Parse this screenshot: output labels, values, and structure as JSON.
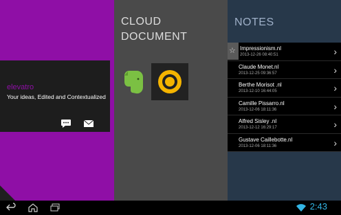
{
  "left_panel": {
    "brand": "elevatro",
    "tagline": "Your ideas, Edited and Contextualized",
    "icons": [
      "chat-icon",
      "mail-icon"
    ],
    "color": "#8f0fa6"
  },
  "mid_panel": {
    "title_line1": "CLOUD",
    "title_line2": "DOCUMENT",
    "apps": [
      "evernote-icon",
      "chrome-icon"
    ]
  },
  "right_panel": {
    "title": "NOTES",
    "notes": [
      {
        "title": "Impressionism.nl",
        "date": "2013-12-26 08:40:51"
      },
      {
        "title": "Claude Monet.nl",
        "date": "2013-12-25 09:36:57"
      },
      {
        "title": "Berthe Morisot .nl",
        "date": "2013-12-10 16:44:05"
      },
      {
        "title": "Camille Pissarro.nl",
        "date": "2013-12-06 18:11:36"
      },
      {
        "title": "Alfred Sisley .nl",
        "date": "2013-12-12 16:29:17"
      },
      {
        "title": "Gustave Caillebotte.nl",
        "date": "2013-12-06 18:11:36"
      }
    ]
  },
  "navbar": {
    "icons": [
      "back-icon",
      "home-icon",
      "recent-apps-icon"
    ],
    "time": "2:43"
  }
}
